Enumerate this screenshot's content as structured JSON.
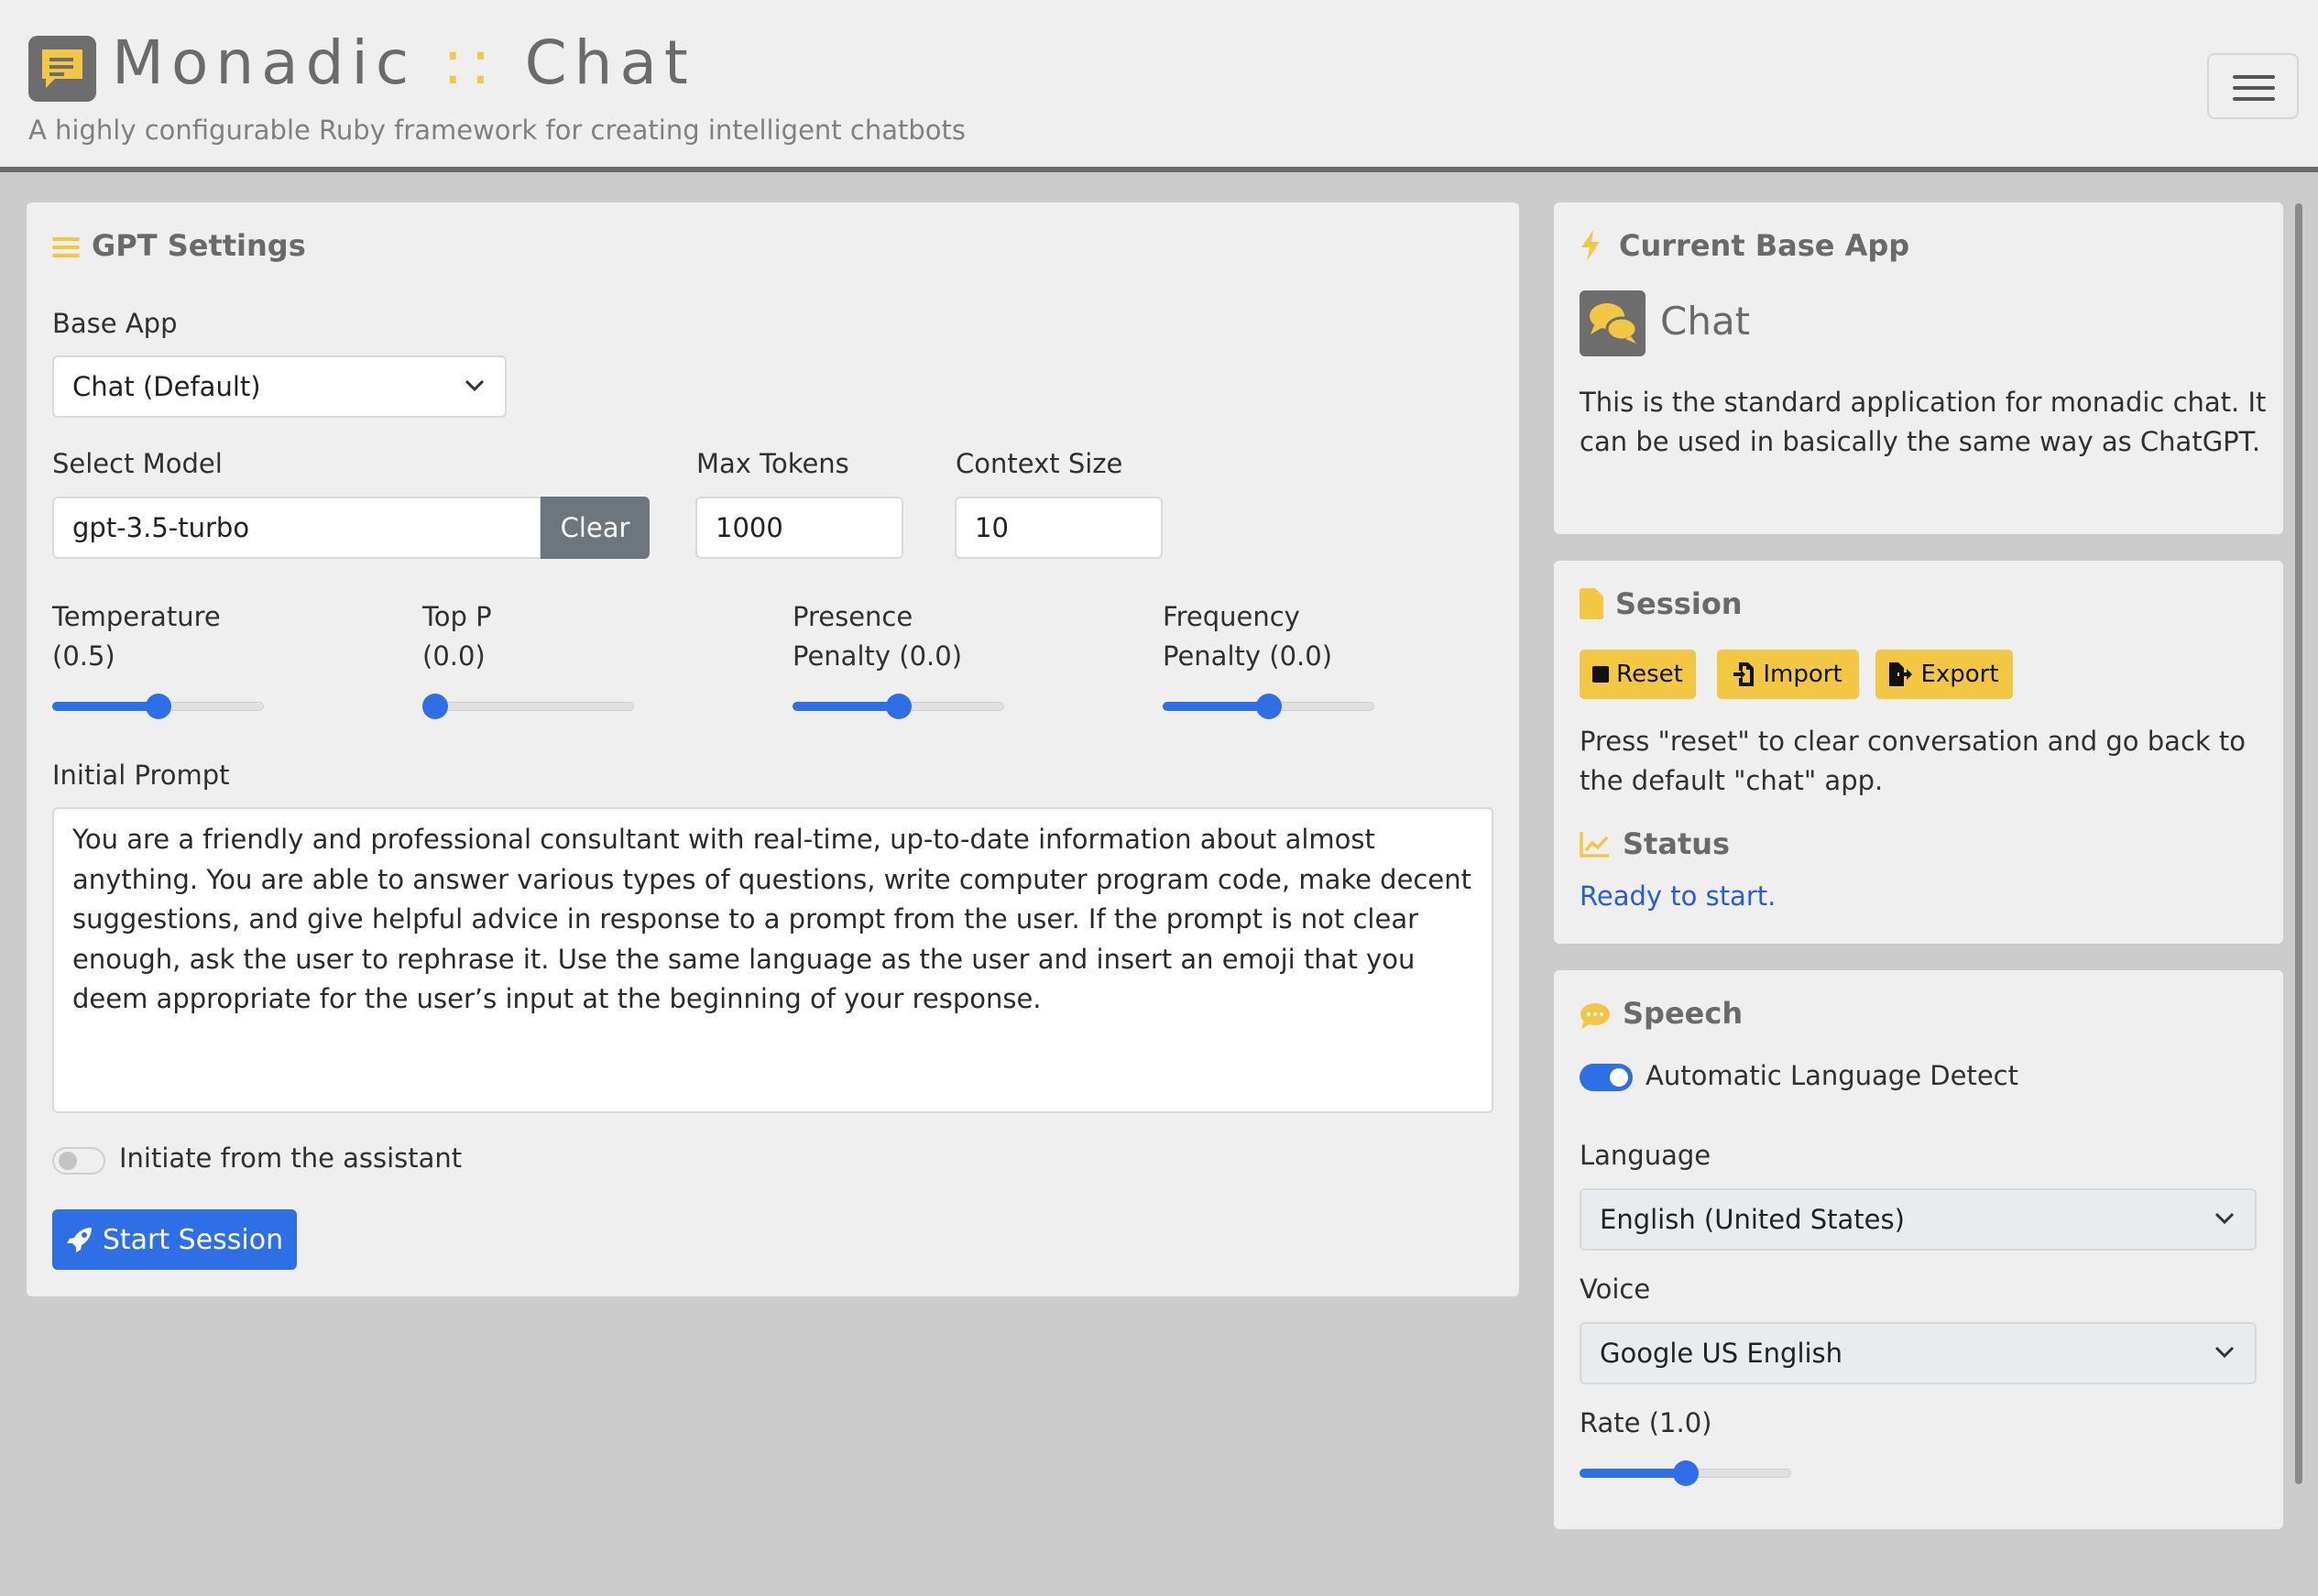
{
  "header": {
    "title_left": "Monadic",
    "title_sep": "::",
    "title_right": "Chat",
    "subtitle": "A highly configurable Ruby framework for creating intelligent chatbots"
  },
  "gpt_settings": {
    "title": "GPT Settings",
    "base_app_label": "Base App",
    "base_app_value": "Chat (Default)",
    "select_model_label": "Select Model",
    "model_value": "gpt-3.5-turbo",
    "clear_label": "Clear",
    "max_tokens_label": "Max Tokens",
    "max_tokens_value": "1000",
    "context_size_label": "Context Size",
    "context_size_value": "10",
    "sliders": [
      {
        "line1": "Temperature",
        "line2": "(0.5)",
        "value": 0.5
      },
      {
        "line1": "Top P",
        "line2": "(0.0)",
        "value": 0.0
      },
      {
        "line1": "Presence",
        "line2": "Penalty (0.0)",
        "value": 0.5
      },
      {
        "line1": "Frequency",
        "line2": "Penalty (0.0)",
        "value": 0.5
      }
    ],
    "initial_prompt_label": "Initial Prompt",
    "initial_prompt_text": "You are a friendly and professional consultant with real-time, up-to-date information about almost anything. You are able to answer various types of questions, write computer program code, make decent suggestions, and give helpful advice in response to a prompt from the user. If the prompt is not clear enough, ask the user to rephrase it. Use the same language as the user and insert an emoji that you deem appropriate for the user’s input at the beginning of your response.",
    "initiate_label": "Initiate from the assistant",
    "initiate_on": false,
    "start_label": "Start Session"
  },
  "current_app": {
    "title": "Current Base App",
    "app_name": "Chat",
    "description": "This is the standard application for monadic chat. It can be used in basically the same way as ChatGPT."
  },
  "session": {
    "title": "Session",
    "reset_label": "Reset",
    "import_label": "Import",
    "export_label": "Export",
    "note": "Press \"reset\" to clear conversation and go back to the default \"chat\" app.",
    "status_title": "Status",
    "status_text": "Ready to start."
  },
  "speech": {
    "title": "Speech",
    "auto_detect_label": "Automatic Language Detect",
    "auto_detect_on": true,
    "language_label": "Language",
    "language_value": "English (United States)",
    "voice_label": "Voice",
    "voice_value": "Google US English",
    "rate_label": "Rate (1.0)",
    "rate_value": 0.5
  },
  "colors": {
    "accent": "#2f6fe6",
    "warning": "#f2c744",
    "status_link": "#2a5bd7"
  },
  "icons": [
    "chat-bubble-icon",
    "bars-icon",
    "bolt-icon",
    "comments-icon",
    "file-icon",
    "stop-icon",
    "file-import-icon",
    "file-export-icon",
    "chart-line-icon",
    "comment-dots-icon",
    "rocket-icon",
    "chevron-down-icon",
    "hamburger-icon"
  ]
}
